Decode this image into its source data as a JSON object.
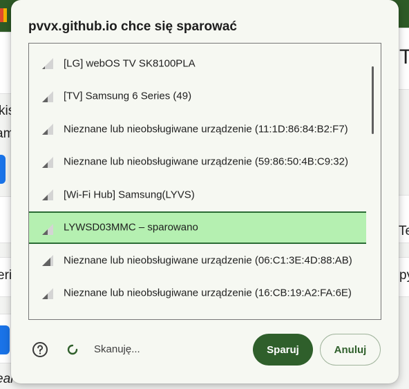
{
  "dialog": {
    "title": "pvvx.github.io chce się sparować",
    "status": "Skanuję...",
    "pair_label": "Sparuj",
    "cancel_label": "Anuluj"
  },
  "devices": [
    {
      "label": "[LG] webOS TV SK8100PLA",
      "signal": 1,
      "selected": false
    },
    {
      "label": "[TV] Samsung 6 Series (49)",
      "signal": 2,
      "selected": false
    },
    {
      "label": "Nieznane lub nieobsługiwane urządzenie (11:1D:86:84:B2:F7)",
      "signal": 2,
      "selected": false
    },
    {
      "label": "Nieznane lub nieobsługiwane urządzenie (59:86:50:4B:C9:32)",
      "signal": 2,
      "selected": false
    },
    {
      "label": "[Wi-Fi Hub] Samsung(LYVS)",
      "signal": 2,
      "selected": false
    },
    {
      "label": "LYWSD03MMC – sparowano",
      "signal": 2,
      "selected": true
    },
    {
      "label": "Nieznane lub nieobsługiwane urządzenie (06:C1:3E:4D:88:AB)",
      "signal": 3,
      "selected": false
    },
    {
      "label": "Nieznane lub nieobsługiwane urządzenie (16:CB:19:A2:FA:6E)",
      "signal": 2,
      "selected": false
    }
  ],
  "background": {
    "fragments": [
      "kis",
      "am",
      "Te",
      "Te",
      "eri",
      "py",
      "ear"
    ]
  },
  "colors": {
    "accent": "#2f5f2b",
    "selected_row": "#b5f0b1",
    "top_bar": "#2e5b27"
  }
}
